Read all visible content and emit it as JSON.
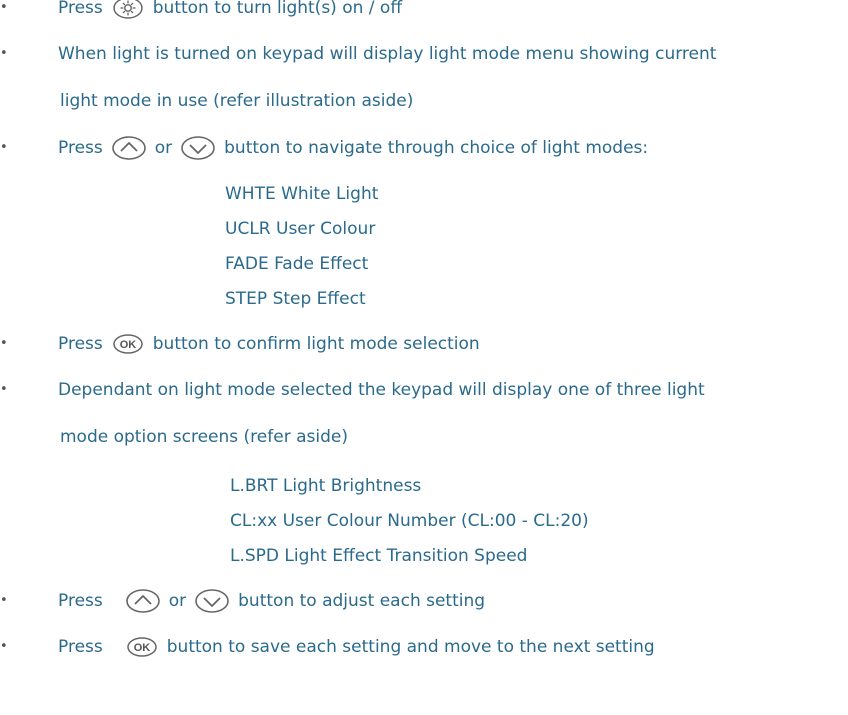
{
  "bullets": [
    {
      "id": "b1",
      "pre": "Press",
      "icon": "sun-icon",
      "post": "button to turn light(s) on / off"
    },
    {
      "id": "b2",
      "line1": "When light is turned on keypad will display light mode menu showing current",
      "line2": "light mode in use (refer illustration aside)"
    },
    {
      "id": "b3",
      "pre": "Press",
      "icon1": "chevron-up-icon",
      "mid": "or",
      "icon2": "chevron-down-icon",
      "post": "button to navigate through choice of light modes:"
    },
    {
      "id": "b4",
      "pre": "Press",
      "icon": "ok-icon",
      "post": "button to confirm light mode selection"
    },
    {
      "id": "b5",
      "line1": "Dependant on light mode selected the keypad will display one of three light",
      "line2": "mode option screens (refer aside)"
    },
    {
      "id": "b6",
      "pre": "Press",
      "icon1": "chevron-up-icon",
      "mid": "or",
      "icon2": "chevron-down-icon",
      "post": "button to adjust each setting"
    },
    {
      "id": "b7",
      "pre": "Press",
      "icon": "ok-icon",
      "post": "button to save each setting and move to the next setting"
    }
  ],
  "light_modes": [
    "WHTE White Light",
    "UCLR User Colour",
    "FADE Fade Effect",
    "STEP Step Effect"
  ],
  "option_screens": [
    "L.BRT Light Brightness",
    "CL:xx User Colour Number (CL:00 - CL:20)",
    "L.SPD Light Effect Transition Speed"
  ],
  "bullet_char": "•",
  "colors": {
    "text": "#2a6a8c",
    "icon_stroke": "#666666"
  }
}
